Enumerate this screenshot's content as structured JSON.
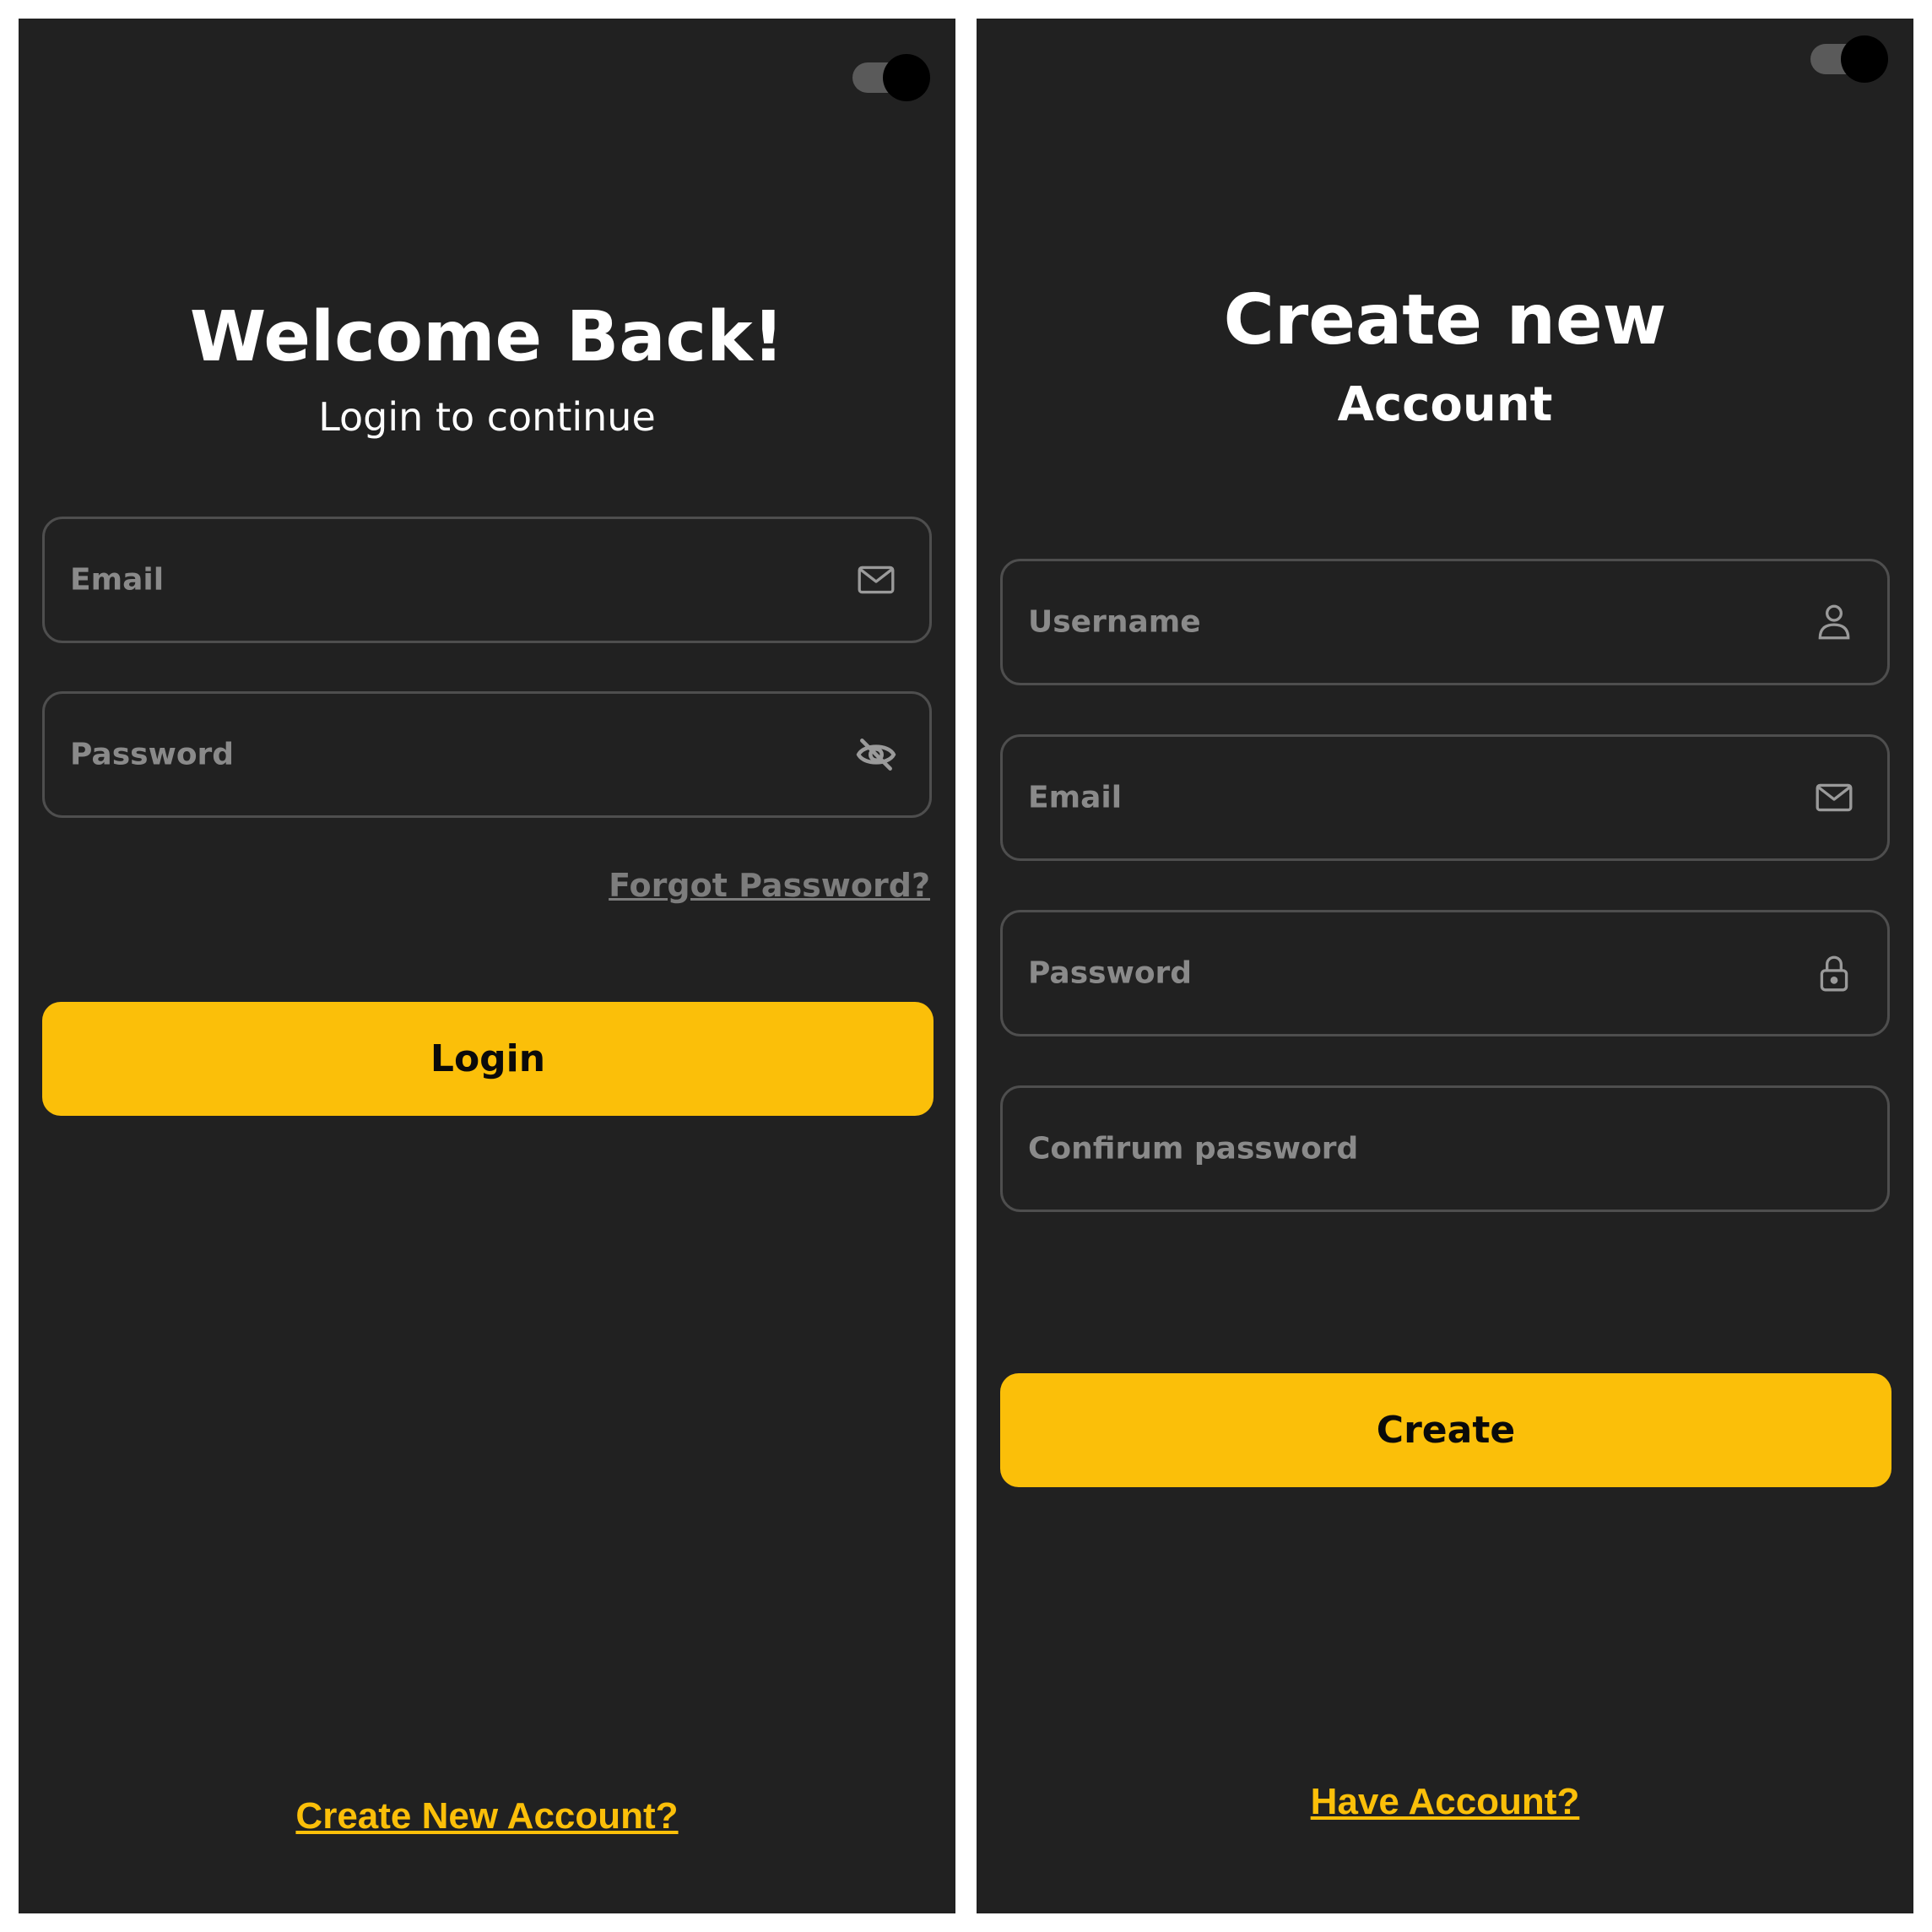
{
  "login": {
    "title": "Welcome Back!",
    "subtitle": "Login to continue",
    "email_placeholder": "Email",
    "password_placeholder": "Password",
    "forgot_link": "Forgot Password?",
    "login_button": "Login",
    "create_link": "Create New Account?"
  },
  "create": {
    "title_line1": "Create new",
    "title_line2": "Account",
    "username_placeholder": "Username",
    "email_placeholder": "Email",
    "password_placeholder": "Password",
    "confirm_placeholder": "Confirum password",
    "create_button": "Create",
    "have_account_link": "Have Account?"
  },
  "icons": {
    "email": "mail-icon",
    "password_visibility": "eye-off-icon",
    "username": "user-icon",
    "lock": "lock-icon"
  },
  "colors": {
    "panel_background": "#212121",
    "accent": "#fbbf09",
    "field_border": "#4e4e4e",
    "placeholder_text": "#8a8a8a"
  }
}
